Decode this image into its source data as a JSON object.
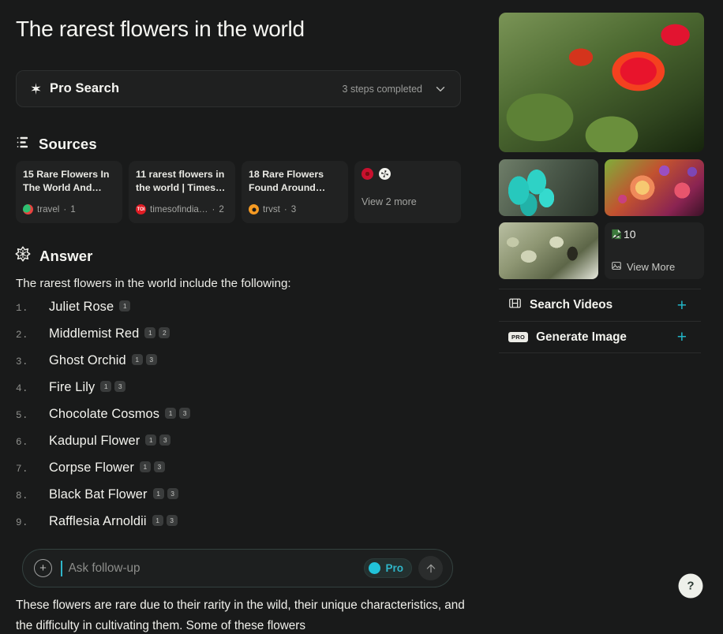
{
  "header": {
    "title": "The rarest flowers in the world"
  },
  "pro_search": {
    "icon": "sparkle-icon",
    "label": "Pro Search",
    "status": "3 steps completed",
    "chevron": "chevron-down-icon"
  },
  "sources": {
    "icon": "sources-list-icon",
    "title": "Sources",
    "cards": [
      {
        "title": "15 Rare Flowers In The World And Wh…",
        "domain": "travel",
        "index": "1",
        "favicon": "travel-favicon"
      },
      {
        "title": "11 rarest flowers in the world | Times o…",
        "domain": "timesofindia…",
        "index": "2",
        "favicon": "toi-favicon"
      },
      {
        "title": "18 Rare Flowers Found Around the…",
        "domain": "trvst",
        "index": "3",
        "favicon": "trvst-favicon"
      }
    ],
    "more": {
      "label": "View 2 more",
      "icons": [
        "red-lotus-favicon",
        "white-flower-favicon"
      ]
    }
  },
  "answer": {
    "icon": "perplexity-answer-icon",
    "title": "Answer",
    "intro": "The rarest flowers in the world include the following:",
    "items": [
      {
        "num": "1.",
        "name": "Juliet Rose",
        "cites": [
          "1"
        ]
      },
      {
        "num": "2.",
        "name": "Middlemist Red",
        "cites": [
          "1",
          "2"
        ]
      },
      {
        "num": "3.",
        "name": "Ghost Orchid",
        "cites": [
          "1",
          "3"
        ]
      },
      {
        "num": "4.",
        "name": "Fire Lily",
        "cites": [
          "1",
          "3"
        ]
      },
      {
        "num": "5.",
        "name": "Chocolate Cosmos",
        "cites": [
          "1",
          "3"
        ]
      },
      {
        "num": "6.",
        "name": "Kadupul Flower",
        "cites": [
          "1",
          "3"
        ]
      },
      {
        "num": "7.",
        "name": "Corpse Flower",
        "cites": [
          "1",
          "3"
        ]
      },
      {
        "num": "8.",
        "name": "Black Bat Flower",
        "cites": [
          "1",
          "3"
        ]
      },
      {
        "num": "9.",
        "name": "Rafflesia Arnoldii",
        "cites": [
          "1",
          "3"
        ]
      }
    ],
    "tail": "These flowers are rare due to their rarity in the wild, their unique characteristics, and the difficulty in cultivating them. Some of these flowers"
  },
  "followup": {
    "plus_icon": "plus-circle-icon",
    "placeholder": "Ask follow-up",
    "value": "",
    "pro_label": "Pro",
    "pro_enabled": true,
    "send_icon": "arrow-up-icon"
  },
  "media": {
    "hero_alt": "fire-lily-photo",
    "thumbs": [
      {
        "alt": "jade-vine-photo"
      },
      {
        "alt": "rose-bouquet-photo"
      }
    ],
    "last_thumb": {
      "alt": "black-bat-flower-photo"
    },
    "view_more": {
      "broken_image_alt": "10",
      "label": "View More",
      "icon": "image-icon"
    }
  },
  "actions": [
    {
      "icon": "video-film-icon",
      "label": "Search Videos",
      "plus": "+",
      "badge": null
    },
    {
      "icon": "pro-badge-icon",
      "label": "Generate Image",
      "plus": "+",
      "badge": "PRO"
    }
  ],
  "help": {
    "label": "?"
  },
  "colors": {
    "background": "#191a1a",
    "card": "#212222",
    "accent_cyan": "#21b4c6",
    "pro_toggle": "#21c3da",
    "text_primary": "#f3f3ee",
    "text_muted": "#9b9c9a"
  }
}
